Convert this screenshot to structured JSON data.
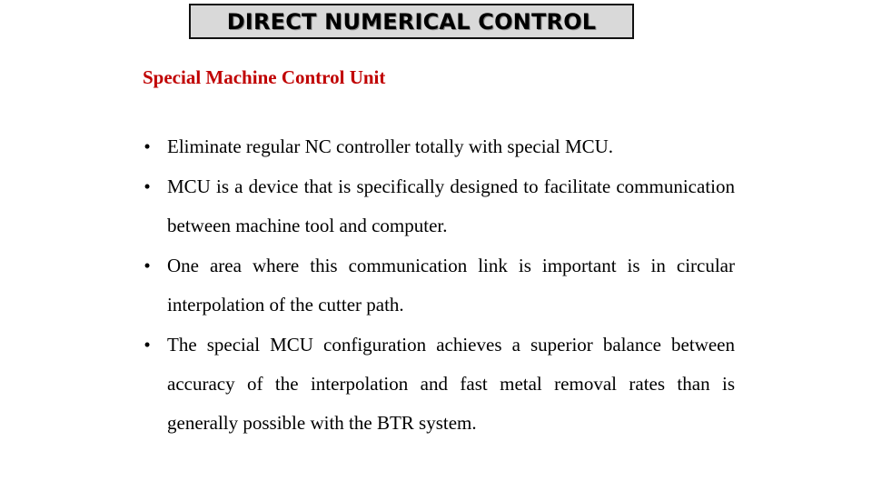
{
  "slide": {
    "title": "DIRECT NUMERICAL CONTROL",
    "subtitle": "Special Machine Control Unit",
    "bullet_glyph": "•",
    "bullets": [
      "Eliminate regular NC controller totally with special MCU.",
      "MCU is a device that is specifically designed to facilitate communication between  machine tool and computer.",
      "One area where this communication link is important is in circular interpolation of the cutter path.",
      "The special MCU configuration achieves a superior balance between accuracy of the interpolation and fast metal removal rates than is generally possible with the BTR system."
    ]
  },
  "colors": {
    "title_background": "#d9d9d9",
    "title_border": "#111111",
    "subtitle": "#c00000",
    "body_text": "#000000"
  }
}
